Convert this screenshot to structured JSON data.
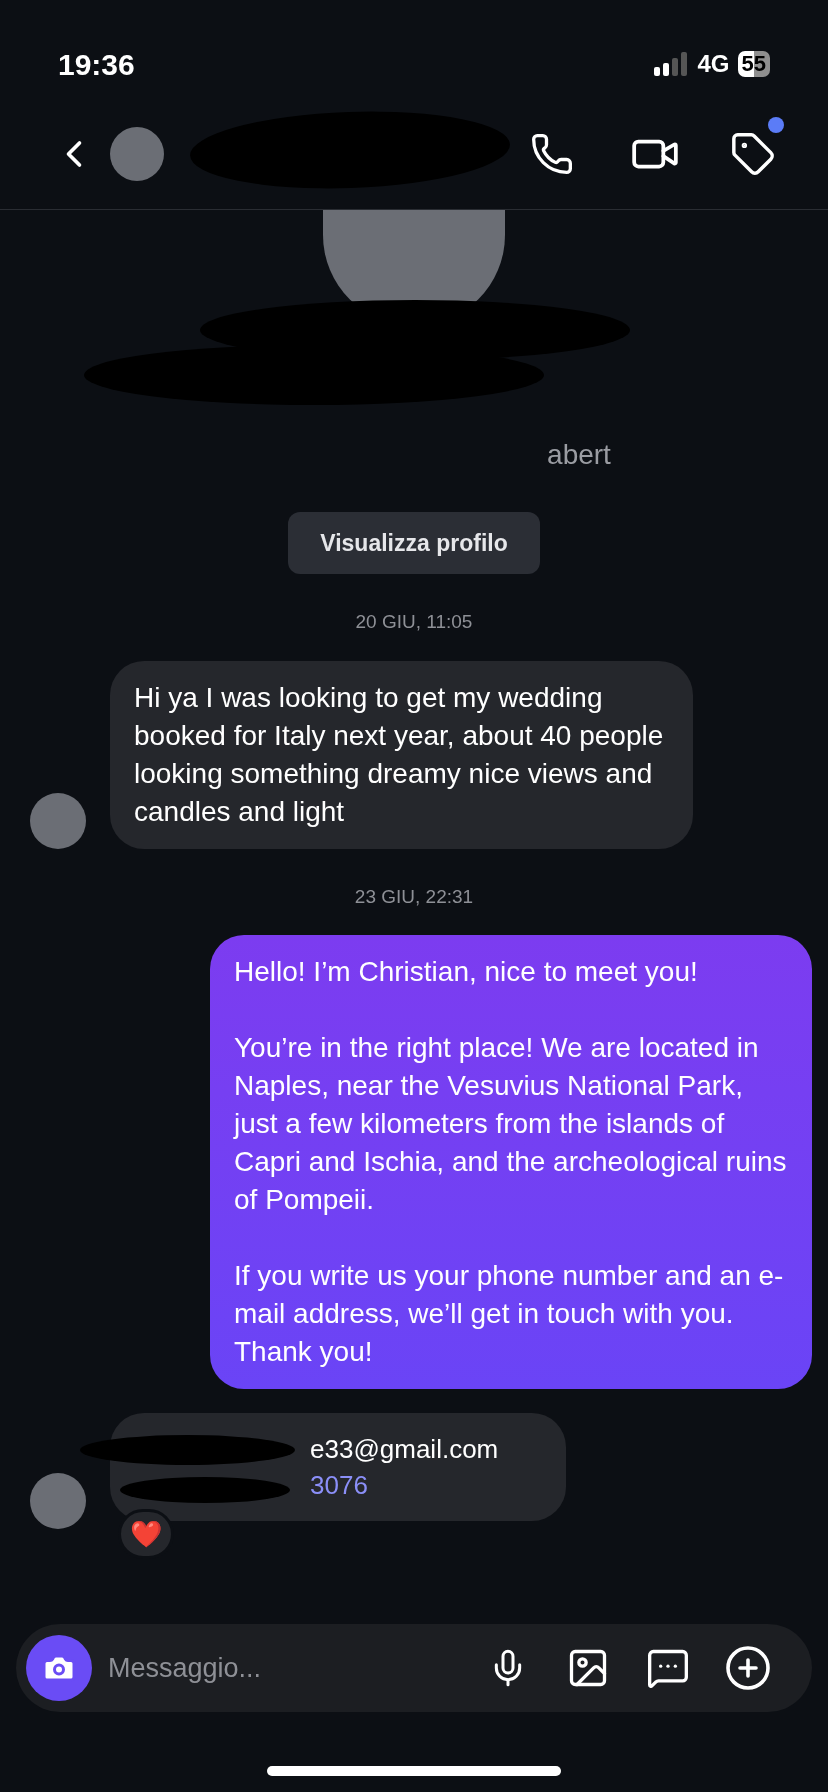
{
  "status_bar": {
    "time": "19:36",
    "network": "4G",
    "battery": "55"
  },
  "header": {
    "tag_badge": true
  },
  "profile": {
    "username_fragment": "abert",
    "button": "Visualizza profilo"
  },
  "messages": [
    {
      "kind": "timestamp",
      "text": "20 GIU, 11:05"
    },
    {
      "kind": "incoming",
      "paragraphs": [
        "Hi ya I was looking to get my wedding booked for Italy next year, about 40 people looking something dreamy nice views and candles and light"
      ]
    },
    {
      "kind": "timestamp",
      "text": "23 GIU, 22:31"
    },
    {
      "kind": "outgoing",
      "paragraphs": [
        "Hello! I’m Christian, nice to meet you!",
        "You’re in the right place! We are located in Naples, near the Vesuvius National Park, just a few kilometers from the islands of Capri and Ischia, and the archeological ruins of Pompeii.",
        "If you write us your phone number and an e-mail address, we’ll get in touch with you. Thank you!"
      ]
    },
    {
      "kind": "incoming_redacted",
      "lines": [
        {
          "text": "e33@gmail.com",
          "link": false
        },
        {
          "text": "3076",
          "link": true
        }
      ],
      "reaction": "❤️"
    }
  ],
  "composer": {
    "placeholder": "Messaggio..."
  }
}
